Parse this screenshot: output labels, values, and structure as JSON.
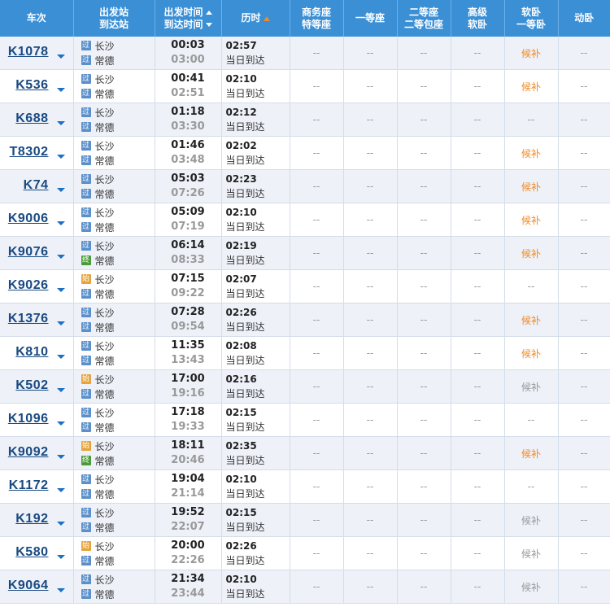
{
  "header": {
    "train": "车次",
    "station_top": "出发站",
    "station_bottom": "到达站",
    "time_top": "出发时间",
    "time_bottom": "到达时间",
    "duration": "历时",
    "biz_top": "商务座",
    "biz_bottom": "特等座",
    "first": "一等座",
    "second_top": "二等座",
    "second_bottom": "二等包座",
    "soft_top": "高级",
    "soft_bottom": "软卧",
    "softbed_top": "软卧",
    "softbed_bottom": "一等卧",
    "dongwo": "动卧"
  },
  "colors": {
    "header_bg": "#3a8fd5",
    "train_link": "#194a82",
    "houbu_orange": "#f08a24",
    "houbu_gray": "#999999",
    "badge_guo": "#5a8fca",
    "badge_shi": "#e6a33c",
    "badge_zhong": "#4c9b3a"
  },
  "rows": [
    {
      "train": "K1078",
      "from_badge": "过",
      "from": "长沙",
      "to_badge": "过",
      "to": "常德",
      "dep": "00:03",
      "arr": "03:00",
      "dur": "02:57",
      "arr_day": "当日到达",
      "c1": "--",
      "c2": "--",
      "c3": "--",
      "c4": "--",
      "c5": "候补",
      "c5_color": "orange",
      "c6": "--"
    },
    {
      "train": "K536",
      "from_badge": "过",
      "from": "长沙",
      "to_badge": "过",
      "to": "常德",
      "dep": "00:41",
      "arr": "02:51",
      "dur": "02:10",
      "arr_day": "当日到达",
      "c1": "--",
      "c2": "--",
      "c3": "--",
      "c4": "--",
      "c5": "候补",
      "c5_color": "orange",
      "c6": "--"
    },
    {
      "train": "K688",
      "from_badge": "过",
      "from": "长沙",
      "to_badge": "过",
      "to": "常德",
      "dep": "01:18",
      "arr": "03:30",
      "dur": "02:12",
      "arr_day": "当日到达",
      "c1": "--",
      "c2": "--",
      "c3": "--",
      "c4": "--",
      "c5": "--",
      "c5_color": "gray",
      "c6": "--"
    },
    {
      "train": "T8302",
      "from_badge": "过",
      "from": "长沙",
      "to_badge": "过",
      "to": "常德",
      "dep": "01:46",
      "arr": "03:48",
      "dur": "02:02",
      "arr_day": "当日到达",
      "c1": "--",
      "c2": "--",
      "c3": "--",
      "c4": "--",
      "c5": "候补",
      "c5_color": "orange",
      "c6": "--"
    },
    {
      "train": "K74",
      "from_badge": "过",
      "from": "长沙",
      "to_badge": "过",
      "to": "常德",
      "dep": "05:03",
      "arr": "07:26",
      "dur": "02:23",
      "arr_day": "当日到达",
      "c1": "--",
      "c2": "--",
      "c3": "--",
      "c4": "--",
      "c5": "候补",
      "c5_color": "orange",
      "c6": "--"
    },
    {
      "train": "K9006",
      "from_badge": "过",
      "from": "长沙",
      "to_badge": "过",
      "to": "常德",
      "dep": "05:09",
      "arr": "07:19",
      "dur": "02:10",
      "arr_day": "当日到达",
      "c1": "--",
      "c2": "--",
      "c3": "--",
      "c4": "--",
      "c5": "候补",
      "c5_color": "orange",
      "c6": "--"
    },
    {
      "train": "K9076",
      "from_badge": "过",
      "from": "长沙",
      "to_badge": "终",
      "to": "常德",
      "dep": "06:14",
      "arr": "08:33",
      "dur": "02:19",
      "arr_day": "当日到达",
      "c1": "--",
      "c2": "--",
      "c3": "--",
      "c4": "--",
      "c5": "候补",
      "c5_color": "orange",
      "c6": "--"
    },
    {
      "train": "K9026",
      "from_badge": "始",
      "from": "长沙",
      "to_badge": "过",
      "to": "常德",
      "dep": "07:15",
      "arr": "09:22",
      "dur": "02:07",
      "arr_day": "当日到达",
      "c1": "--",
      "c2": "--",
      "c3": "--",
      "c4": "--",
      "c5": "--",
      "c5_color": "gray",
      "c6": "--"
    },
    {
      "train": "K1376",
      "from_badge": "过",
      "from": "长沙",
      "to_badge": "过",
      "to": "常德",
      "dep": "07:28",
      "arr": "09:54",
      "dur": "02:26",
      "arr_day": "当日到达",
      "c1": "--",
      "c2": "--",
      "c3": "--",
      "c4": "--",
      "c5": "候补",
      "c5_color": "orange",
      "c6": "--"
    },
    {
      "train": "K810",
      "from_badge": "过",
      "from": "长沙",
      "to_badge": "过",
      "to": "常德",
      "dep": "11:35",
      "arr": "13:43",
      "dur": "02:08",
      "arr_day": "当日到达",
      "c1": "--",
      "c2": "--",
      "c3": "--",
      "c4": "--",
      "c5": "候补",
      "c5_color": "orange",
      "c6": "--"
    },
    {
      "train": "K502",
      "from_badge": "始",
      "from": "长沙",
      "to_badge": "过",
      "to": "常德",
      "dep": "17:00",
      "arr": "19:16",
      "dur": "02:16",
      "arr_day": "当日到达",
      "c1": "--",
      "c2": "--",
      "c3": "--",
      "c4": "--",
      "c5": "候补",
      "c5_color": "gray",
      "c6": "--"
    },
    {
      "train": "K1096",
      "from_badge": "过",
      "from": "长沙",
      "to_badge": "过",
      "to": "常德",
      "dep": "17:18",
      "arr": "19:33",
      "dur": "02:15",
      "arr_day": "当日到达",
      "c1": "--",
      "c2": "--",
      "c3": "--",
      "c4": "--",
      "c5": "--",
      "c5_color": "gray",
      "c6": "--"
    },
    {
      "train": "K9092",
      "from_badge": "始",
      "from": "长沙",
      "to_badge": "终",
      "to": "常德",
      "dep": "18:11",
      "arr": "20:46",
      "dur": "02:35",
      "arr_day": "当日到达",
      "c1": "--",
      "c2": "--",
      "c3": "--",
      "c4": "--",
      "c5": "候补",
      "c5_color": "orange",
      "c6": "--"
    },
    {
      "train": "K1172",
      "from_badge": "过",
      "from": "长沙",
      "to_badge": "过",
      "to": "常德",
      "dep": "19:04",
      "arr": "21:14",
      "dur": "02:10",
      "arr_day": "当日到达",
      "c1": "--",
      "c2": "--",
      "c3": "--",
      "c4": "--",
      "c5": "--",
      "c5_color": "gray",
      "c6": "--"
    },
    {
      "train": "K192",
      "from_badge": "过",
      "from": "长沙",
      "to_badge": "过",
      "to": "常德",
      "dep": "19:52",
      "arr": "22:07",
      "dur": "02:15",
      "arr_day": "当日到达",
      "c1": "--",
      "c2": "--",
      "c3": "--",
      "c4": "--",
      "c5": "候补",
      "c5_color": "gray",
      "c6": "--"
    },
    {
      "train": "K580",
      "from_badge": "始",
      "from": "长沙",
      "to_badge": "过",
      "to": "常德",
      "dep": "20:00",
      "arr": "22:26",
      "dur": "02:26",
      "arr_day": "当日到达",
      "c1": "--",
      "c2": "--",
      "c3": "--",
      "c4": "--",
      "c5": "候补",
      "c5_color": "gray",
      "c6": "--"
    },
    {
      "train": "K9064",
      "from_badge": "过",
      "from": "长沙",
      "to_badge": "过",
      "to": "常德",
      "dep": "21:34",
      "arr": "23:44",
      "dur": "02:10",
      "arr_day": "当日到达",
      "c1": "--",
      "c2": "--",
      "c3": "--",
      "c4": "--",
      "c5": "候补",
      "c5_color": "gray",
      "c6": "--"
    }
  ]
}
